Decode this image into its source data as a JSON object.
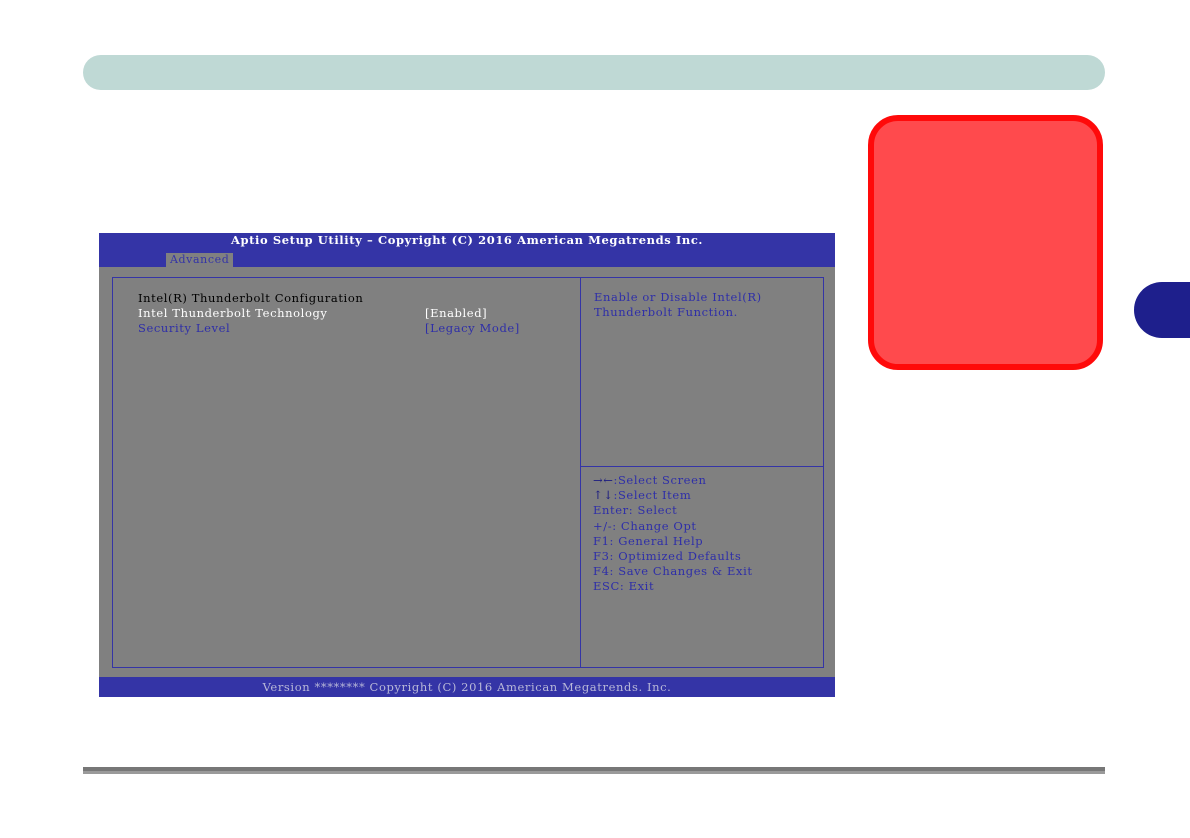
{
  "page": {
    "banner_color": "#bfd9d5",
    "callout_color": "#ff4a4d",
    "callout_border_color": "#ff0a0a",
    "chapter_tab_color": "#1e1f8c"
  },
  "bios": {
    "header_color": "#3434a6",
    "background_color": "#808080",
    "title": "Aptio Setup Utility – Copyright (C) 2016 American Megatrends Inc.",
    "active_tab": "Advanced",
    "section_heading": "Intel(R) Thunderbolt Configuration",
    "settings": [
      {
        "label": "Intel Thunderbolt Technology",
        "value": "[Enabled]",
        "selected": true
      },
      {
        "label": "Security Level",
        "value": "[Legacy Mode]",
        "selected": false
      }
    ],
    "help_text": "Enable or Disable Intel(R) Thunderbolt Function.",
    "key_legend": [
      {
        "key": "→←",
        "action": ":Select Screen"
      },
      {
        "key": "↑↓",
        "action": ":Select Item"
      },
      {
        "key": "Enter",
        "action": ": Select"
      },
      {
        "key": "+/-",
        "action": ": Change Opt"
      },
      {
        "key": "F1",
        "action": ": General Help"
      },
      {
        "key": "F3",
        "action": ": Optimized Defaults"
      },
      {
        "key": "F4",
        "action": ": Save Changes & Exit"
      },
      {
        "key": "ESC",
        "action": ": Exit"
      }
    ],
    "version": "Version ******** Copyright (C) 2016 American Megatrends. Inc."
  }
}
